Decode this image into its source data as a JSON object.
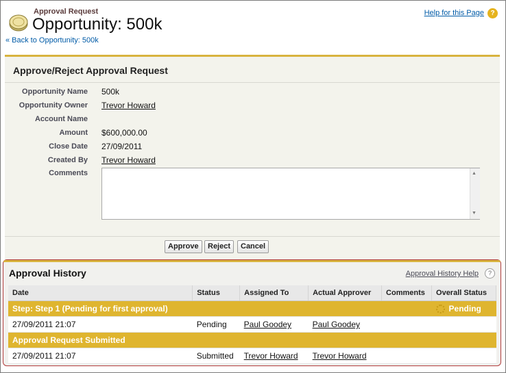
{
  "header": {
    "sub_title": "Approval Request",
    "title": "Opportunity: 500k",
    "back_link": "« Back to Opportunity: 500k",
    "help_link": "Help for this Page",
    "help_icon": "?"
  },
  "approve_block": {
    "title": "Approve/Reject Approval Request",
    "fields": [
      {
        "label": "Opportunity Name",
        "value": "500k",
        "link": false
      },
      {
        "label": "Opportunity Owner",
        "value": "Trevor Howard",
        "link": true
      },
      {
        "label": "Account Name",
        "value": "",
        "link": false
      },
      {
        "label": "Amount",
        "value": "$600,000.00",
        "link": false
      },
      {
        "label": "Close Date",
        "value": "27/09/2011",
        "link": false
      },
      {
        "label": "Created By",
        "value": "Trevor Howard",
        "link": true
      }
    ],
    "comments_label": "Comments",
    "comments_value": "",
    "buttons": {
      "approve": "Approve",
      "reject": "Reject",
      "cancel": "Cancel"
    }
  },
  "history": {
    "title": "Approval History",
    "help_link": "Approval History Help",
    "help_icon": "?",
    "columns": [
      "Date",
      "Status",
      "Assigned To",
      "Actual Approver",
      "Comments",
      "Overall Status"
    ],
    "step1": {
      "label": "Step: Step 1 (Pending for first approval)",
      "overall_status": "Pending"
    },
    "row1": {
      "date": "27/09/2011 21:07",
      "status": "Pending",
      "assigned_to": "Paul Goodey",
      "actual_approver": "Paul Goodey",
      "comments": ""
    },
    "submitted": {
      "label": "Approval Request Submitted"
    },
    "row2": {
      "date": "27/09/2011 21:07",
      "status": "Submitted",
      "assigned_to": "Trevor Howard",
      "actual_approver": "Trevor Howard",
      "comments": ""
    }
  },
  "colors": {
    "accent": "#d8b33e",
    "step_row": "#dfb52f",
    "link": "#015ba7"
  }
}
